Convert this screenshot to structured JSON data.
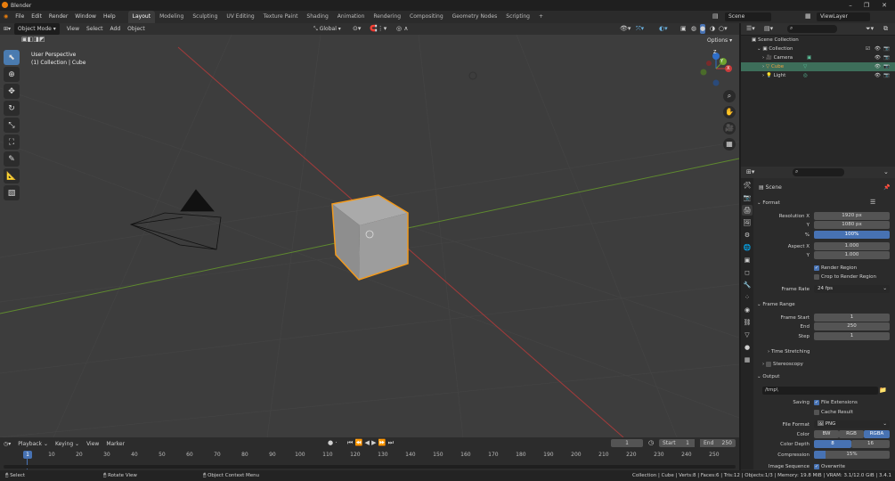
{
  "app": {
    "title": "Blender"
  },
  "window_controls": {
    "minimize": "–",
    "maximize": "❐",
    "close": "✕"
  },
  "menubar": {
    "menus": [
      "File",
      "Edit",
      "Render",
      "Window",
      "Help"
    ],
    "workspaces": [
      "Layout",
      "Modeling",
      "Sculpting",
      "UV Editing",
      "Texture Paint",
      "Shading",
      "Animation",
      "Rendering",
      "Compositing",
      "Geometry Nodes",
      "Scripting"
    ],
    "active_workspace": "Layout",
    "add_workspace": "+",
    "scene": "Scene",
    "view_layer": "ViewLayer"
  },
  "viewport_header": {
    "mode": "Object Mode",
    "menus": [
      "View",
      "Select",
      "Add",
      "Object"
    ],
    "orientation": "Global",
    "options": "Options"
  },
  "viewport": {
    "perspective": "User Perspective",
    "collection_info": "(1) Collection | Cube",
    "gizmo": {
      "x": "X",
      "y": "Y",
      "z": "Z"
    }
  },
  "outliner": {
    "items": [
      {
        "label": "Scene Collection",
        "level": 0
      },
      {
        "label": "Collection",
        "level": 1
      },
      {
        "label": "Camera",
        "level": 2
      },
      {
        "label": "Cube",
        "level": 2,
        "selected": true
      },
      {
        "label": "Light",
        "level": 2
      }
    ]
  },
  "properties": {
    "scene_label": "Scene",
    "format": {
      "header": "Format",
      "resolution_x_label": "Resolution X",
      "resolution_x": "1920 px",
      "y_label": "Y",
      "resolution_y": "1080 px",
      "percent_label": "%",
      "percent": "100%",
      "aspect_x_label": "Aspect X",
      "aspect_x": "1.000",
      "aspect_y_label": "Y",
      "aspect_y": "1.000",
      "render_region": "Render Region",
      "crop_region": "Crop to Render Region",
      "frame_rate_label": "Frame Rate",
      "frame_rate": "24 fps"
    },
    "frame_range": {
      "header": "Frame Range",
      "start_label": "Frame Start",
      "start": "1",
      "end_label": "End",
      "end": "250",
      "step_label": "Step",
      "step": "1"
    },
    "time_stretching": "Time Stretching",
    "stereoscopy": "Stereoscopy",
    "output": {
      "header": "Output",
      "path": "/tmp\\",
      "saving_label": "Saving",
      "file_extensions": "File Extensions",
      "cache_result": "Cache Result",
      "file_format_label": "File Format",
      "file_format": "PNG",
      "color_label": "Color",
      "color_bw": "BW",
      "color_rgb": "RGB",
      "color_rgba": "RGBA",
      "color_depth_label": "Color Depth",
      "depth_8": "8",
      "depth_16": "16",
      "compression_label": "Compression",
      "compression": "15%",
      "image_sequence_label": "Image Sequence",
      "overwrite": "Overwrite"
    }
  },
  "timeline": {
    "menus": [
      "Playback",
      "Keying",
      "View",
      "Marker"
    ],
    "current_frame": "1",
    "start_label": "Start",
    "start": "1",
    "end_label": "End",
    "end": "250",
    "ticks": [
      "10",
      "20",
      "30",
      "40",
      "50",
      "60",
      "70",
      "80",
      "90",
      "100",
      "110",
      "120",
      "130",
      "140",
      "150",
      "160",
      "170",
      "180",
      "190",
      "200",
      "210",
      "220",
      "230",
      "240",
      "250"
    ],
    "playhead": "1"
  },
  "statusbar": {
    "select": "Select",
    "rotate": "Rotate View",
    "context": "Object Context Menu",
    "stats": "Collection | Cube | Verts:8 | Faces:6 | Tris:12 | Objects:1/3 | Memory: 19.8 MiB | VRAM: 3.1/12.0 GiB | 3.4.1"
  }
}
